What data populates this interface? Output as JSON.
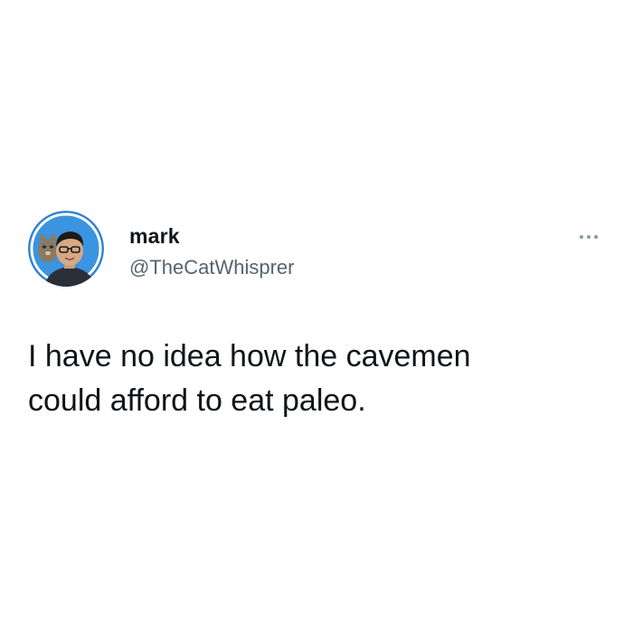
{
  "tweet": {
    "author": {
      "display_name": "mark",
      "handle": "@TheCatWhisprer",
      "avatar_icon": "profile-photo-man-with-glasses-and-cat"
    },
    "text_line_1": "I have no idea how the cavemen",
    "text_line_2": "could afford to eat paleo.",
    "more_icon": "more-options-icon"
  },
  "colors": {
    "background": "#ffffff",
    "name_text": "#0f1419",
    "handle_text": "#536471",
    "body_text": "#0f1419",
    "avatar_ring": "#1d9bf0",
    "more_dots": "#8b98a5"
  }
}
